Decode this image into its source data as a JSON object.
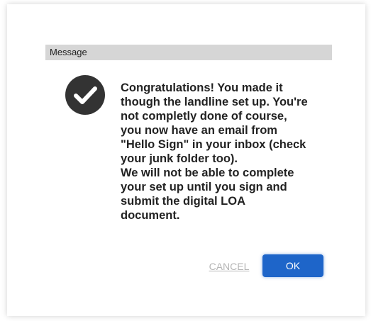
{
  "dialog": {
    "title": "Message",
    "icon": "checkmark-circle-icon",
    "message": "Congratulations! You made it\nthough the landline set up. You're\nnot completly done of course,\nyou now have an email from\n\"Hello Sign\" in your inbox (check\nyour junk folder too).\nWe will not be able to complete\nyour set up until you sign and\nsubmit the digital LOA\ndocument.",
    "cancel_label": "CANCEL",
    "ok_label": "OK"
  },
  "colors": {
    "title_bar": "#d6d6d6",
    "icon": "#333333",
    "ok_button": "#1e65c9",
    "cancel_text": "#b5b5b5"
  }
}
